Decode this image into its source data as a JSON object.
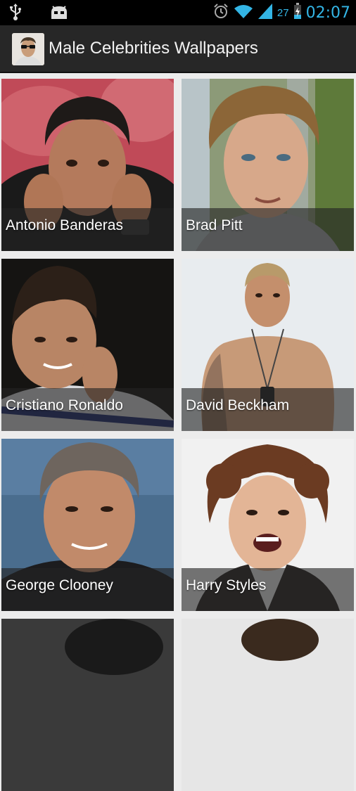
{
  "status_bar": {
    "time": "02:07",
    "battery_level": "27",
    "icons": [
      "usb-icon",
      "android-debug-icon",
      "alarm-icon",
      "wifi-icon",
      "signal-icon",
      "battery-icon"
    ]
  },
  "action_bar": {
    "title": "Male Celebrities Wallpapers",
    "app_icon": "celebrity-avatar-icon"
  },
  "colors": {
    "status_accent": "#33b5e5",
    "action_bar_bg": "#272727",
    "background": "#ececec",
    "caption_bg": "rgba(35,35,35,0.62)"
  },
  "celebrities": [
    {
      "name": "Antonio Banderas"
    },
    {
      "name": "Brad Pitt"
    },
    {
      "name": "Cristiano Ronaldo"
    },
    {
      "name": "David Beckham"
    },
    {
      "name": "George Clooney"
    },
    {
      "name": "Harry Styles"
    },
    {
      "name": ""
    },
    {
      "name": ""
    }
  ]
}
